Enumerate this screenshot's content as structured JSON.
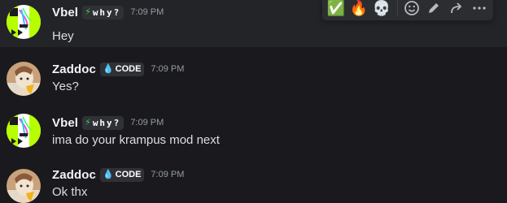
{
  "messages": [
    {
      "author": "Vbel",
      "tag": {
        "icon": "lightning-icon",
        "text": "why?"
      },
      "time": "7:09 PM",
      "text": "Hey"
    },
    {
      "author": "Zaddoc",
      "tag": {
        "icon": "flame-icon",
        "text": "CODE"
      },
      "time": "7:09 PM",
      "text": "Yes?"
    },
    {
      "author": "Vbel",
      "tag": {
        "icon": "lightning-icon",
        "text": "why?"
      },
      "time": "7:09 PM",
      "text": "ima do your krampus mod next"
    },
    {
      "author": "Zaddoc",
      "tag": {
        "icon": "flame-icon",
        "text": "CODE"
      },
      "time": "7:09 PM",
      "text": "Ok thx"
    }
  ],
  "toolbar": {
    "reactions": [
      {
        "icon": "check-mark-emoji",
        "glyph": "✅"
      },
      {
        "icon": "fire-emoji",
        "glyph": "🔥"
      },
      {
        "icon": "skull-emoji",
        "glyph": "💀"
      }
    ],
    "actions": [
      "add-reaction-icon",
      "edit-icon",
      "forward-icon",
      "more-icon"
    ]
  },
  "colors": {
    "background": "#1a1a1e",
    "hover": "#232428",
    "accent_green": "#b7ff00",
    "timestamp": "#949ba4"
  }
}
